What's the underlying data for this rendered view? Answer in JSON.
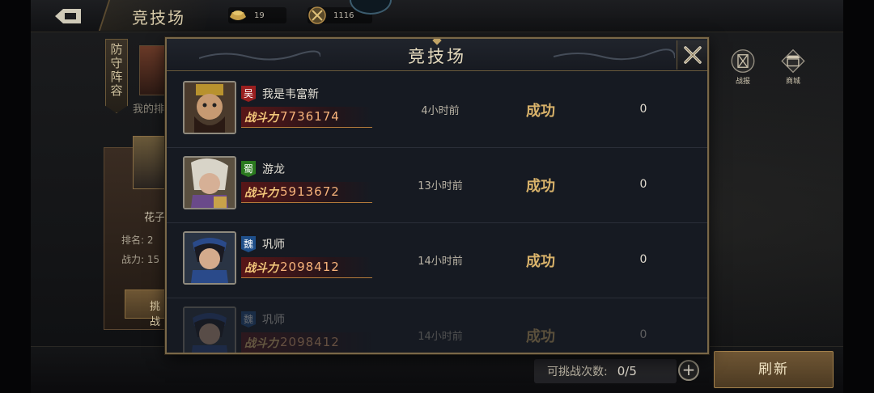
{
  "header": {
    "title": "竞技场",
    "gold": "19",
    "medals": "1116"
  },
  "defense": {
    "banner": "防守阵容",
    "my_rank_label": "我的排"
  },
  "side_card": {
    "name": "花子",
    "rank": "排名: 2",
    "power": "战力: 15",
    "challenge_label": "挑战"
  },
  "side_icons": {
    "battle_report": "战报",
    "shop": "商城"
  },
  "modal": {
    "title": "竞技场",
    "power_label": "战斗力",
    "rows": [
      {
        "faction": "吴",
        "faction_key": "wu",
        "name": "我是韦富新",
        "power": "7736174",
        "time": "4小时前",
        "result": "成功",
        "change": "0"
      },
      {
        "faction": "蜀",
        "faction_key": "shu",
        "name": "游龙",
        "power": "5913672",
        "time": "13小时前",
        "result": "成功",
        "change": "0"
      },
      {
        "faction": "魏",
        "faction_key": "wei",
        "name": "巩师",
        "power": "2098412",
        "time": "14小时前",
        "result": "成功",
        "change": "0"
      },
      {
        "faction": "魏",
        "faction_key": "wei",
        "name": "巩师",
        "power": "2098412",
        "time": "14小时前",
        "result": "成功",
        "change": "0"
      }
    ]
  },
  "footer": {
    "attempts_label": "可挑战次数:",
    "attempts_value": "0/5",
    "plus": "+",
    "refresh_label": "刷新"
  },
  "colors": {
    "accent_gold": "#d8b26a",
    "power_value": "#f6b27a",
    "frame": "#7a6848"
  }
}
